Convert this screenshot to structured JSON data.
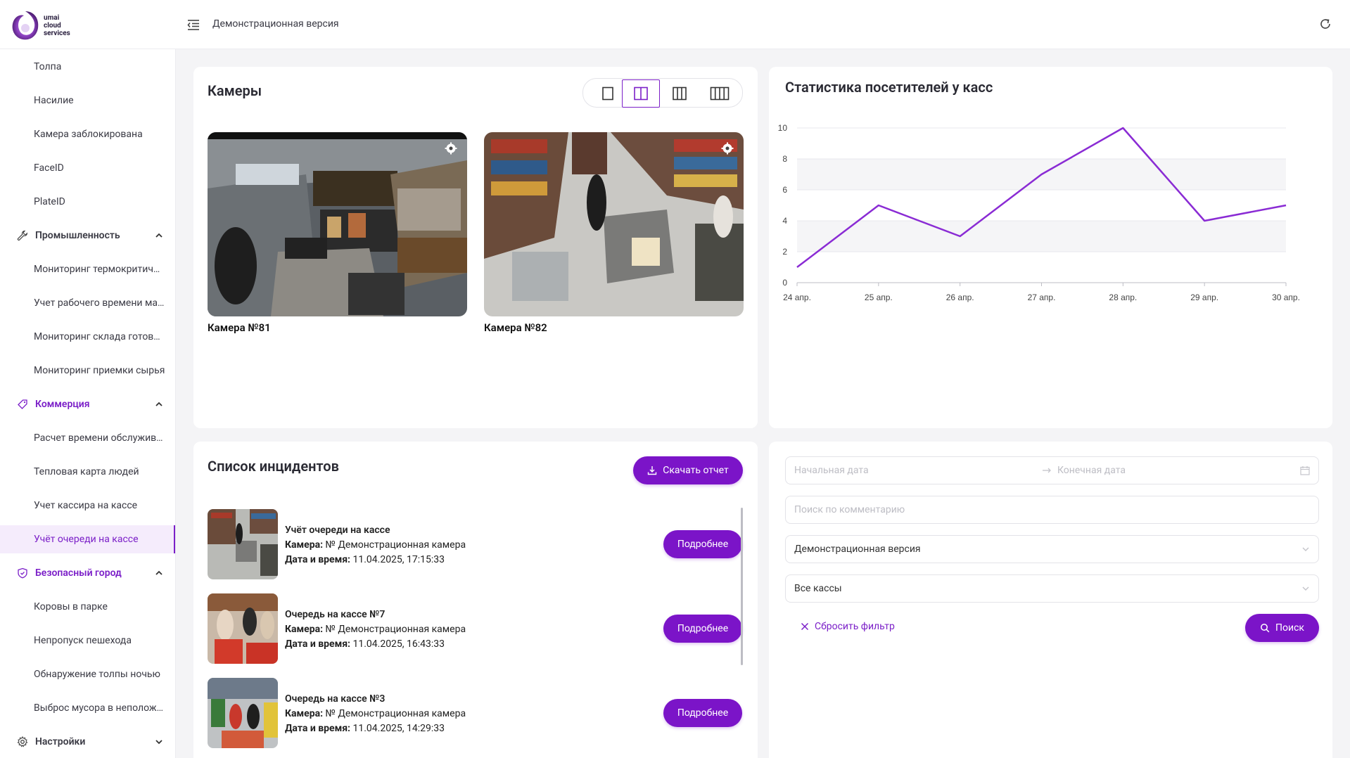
{
  "header": {
    "logo_text": "umai\ncloud\nservices",
    "title": "Демонстрационная версия"
  },
  "sidebar": {
    "items_top": [
      {
        "label": "Толпа"
      },
      {
        "label": "Насилие"
      },
      {
        "label": "Камера заблокирована"
      },
      {
        "label": "FaceID"
      },
      {
        "label": "PlateID"
      }
    ],
    "group_industry": {
      "label": "Промышленность",
      "icon": "wrench-icon"
    },
    "items_industry": [
      {
        "label": "Мониторинг термокритич…"
      },
      {
        "label": "Учет рабочего времени ма…"
      },
      {
        "label": "Мониторинг склада готов…"
      },
      {
        "label": "Мониторинг приемки сырья"
      }
    ],
    "group_commerce": {
      "label": "Коммерция",
      "icon": "tag-icon"
    },
    "items_commerce": [
      {
        "label": "Расчет времени обслужив…"
      },
      {
        "label": "Тепловая карта людей"
      },
      {
        "label": "Учет кассира на кассе"
      },
      {
        "label": "Учёт очереди на кассе"
      }
    ],
    "group_city": {
      "label": "Безопасный город",
      "icon": "shield-icon"
    },
    "items_city": [
      {
        "label": "Коровы в парке"
      },
      {
        "label": "Непропуск пешехода"
      },
      {
        "label": "Обнаружение толпы ночью"
      },
      {
        "label": "Выброс мусора в неполож…"
      }
    ],
    "group_settings": {
      "label": "Настройки",
      "icon": "gear-icon"
    }
  },
  "cameras": {
    "title": "Камеры",
    "items": [
      {
        "label": "Камера №81"
      },
      {
        "label": "Камера №82"
      }
    ]
  },
  "stats": {
    "title": "Статистика посетителей у касс"
  },
  "chart_data": {
    "type": "line",
    "title": "Статистика посетителей у касс",
    "xlabel": "",
    "ylabel": "",
    "categories": [
      "24 апр.",
      "25 апр.",
      "26 апр.",
      "27 апр.",
      "28 апр.",
      "29 апр.",
      "30 апр."
    ],
    "values": [
      1,
      5,
      3,
      7,
      10,
      4,
      5
    ],
    "ylim": [
      0,
      10
    ],
    "yticks": [
      "0",
      "2",
      "4",
      "6",
      "8",
      "10"
    ],
    "color": "#8a2bd4",
    "grid": true
  },
  "incidents": {
    "title": "Список инцидентов",
    "download_label": "Скачать отчет",
    "camera_key": "Камера:",
    "datetime_key": "Дата и время:",
    "details_label": "Подробнее",
    "items": [
      {
        "title": "Учёт очереди на кассе",
        "camera": "№ Демонстрационная камера",
        "datetime": "11.04.2025, 17:15:33"
      },
      {
        "title": "Очередь на кассе №7",
        "camera": "№ Демонстрационная камера",
        "datetime": "11.04.2025, 16:43:33"
      },
      {
        "title": "Очередь на кассе №3",
        "camera": "№ Демонстрационная камера",
        "datetime": "11.04.2025, 14:29:33"
      }
    ]
  },
  "filter": {
    "start_placeholder": "Начальная дата",
    "end_placeholder": "Конечная дата",
    "comment_placeholder": "Поиск по комментарию",
    "version_value": "Демонстрационная версия",
    "kassa_value": "Все кассы",
    "reset_label": "Сбросить фильтр",
    "search_label": "Поиск"
  },
  "colors": {
    "accent": "#7b14c8",
    "line": "#8a2bd4"
  }
}
